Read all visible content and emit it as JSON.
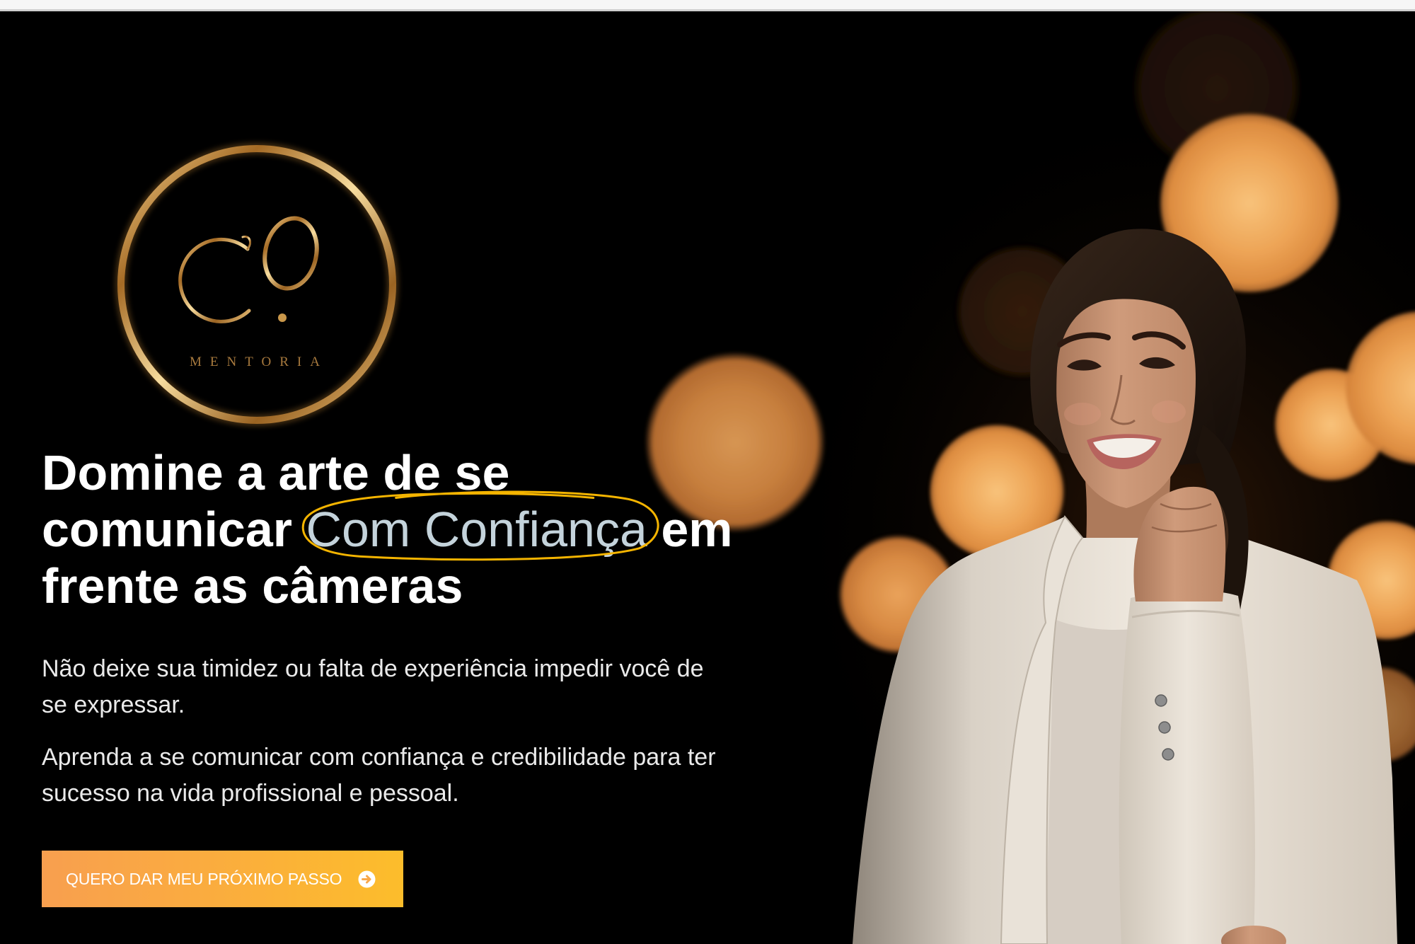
{
  "logo": {
    "monogram": "CO.",
    "wordmark": "MENTORIA"
  },
  "headline": {
    "line1": "Domine a arte de se",
    "line2_start": "comunicar",
    "highlight": "Com Confiança",
    "line2_end": "em",
    "line3": "frente as câmeras"
  },
  "paragraphs": [
    {
      "lines": [
        "Não deixe sua timidez ou falta de experiência impedir você de",
        "se expressar."
      ]
    },
    {
      "lines": [
        "Aprenda a se comunicar com confiança e credibilidade para ter",
        "sucesso na vida profissional e pessoal."
      ]
    }
  ],
  "cta": {
    "label": "QUERO DAR MEU PRÓXIMO PASSO",
    "icon": "arrow-circle-right-icon"
  },
  "colors": {
    "background": "#000000",
    "logo_gold": "#c9974a",
    "headline_text": "#ffffff",
    "highlight_text": "#c4d3db",
    "highlight_ring": "#f4b400",
    "body_text": "#eaeaea",
    "button_gradient_start": "#f89f4f",
    "button_gradient_end": "#fcbd2b",
    "bokeh_orange": "#e9a052"
  }
}
